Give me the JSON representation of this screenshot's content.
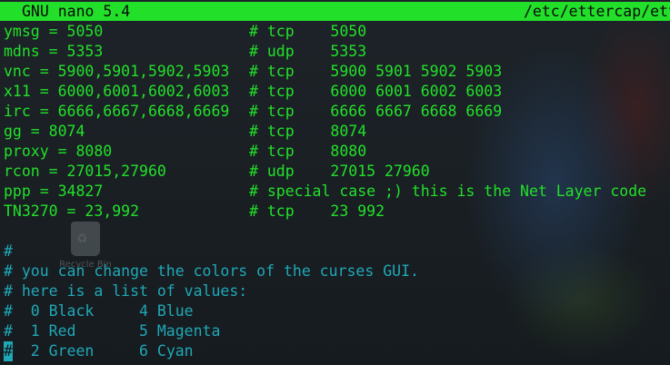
{
  "titlebar": {
    "app": "GNU nano 5.4",
    "path": "/etc/ettercap/ett"
  },
  "desktop": {
    "icon": "trash-icon",
    "caption": "Recycle Bin"
  },
  "config_lines": [
    {
      "setting": "ymsg = 5050",
      "comment": "# tcp    5050"
    },
    {
      "setting": "mdns = 5353",
      "comment": "# udp    5353"
    },
    {
      "setting": "vnc = 5900,5901,5902,5903",
      "comment": "# tcp    5900 5901 5902 5903"
    },
    {
      "setting": "x11 = 6000,6001,6002,6003",
      "comment": "# tcp    6000 6001 6002 6003"
    },
    {
      "setting": "irc = 6666,6667,6668,6669",
      "comment": "# tcp    6666 6667 6668 6669"
    },
    {
      "setting": "gg = 8074",
      "comment": "# tcp    8074"
    },
    {
      "setting": "proxy = 8080",
      "comment": "# tcp    8080"
    },
    {
      "setting": "rcon = 27015,27960",
      "comment": "# udp    27015 27960"
    },
    {
      "setting": "ppp = 34827",
      "comment": "# special case ;) this is the Net Layer code"
    },
    {
      "setting": "TN3270 = 23,992",
      "comment": "# tcp    23 992"
    }
  ],
  "comment_lines": [
    "",
    "#",
    "# you can change the colors of the curses GUI.",
    "# here is a list of values:",
    "#  0 Black     4 Blue",
    "#  1 Red       5 Magenta"
  ],
  "cursor_line": {
    "cursor_char": "#",
    "rest": "  2 Green     6 Cyan"
  },
  "colors": {
    "titlebar_bg": "#22e02a",
    "config_text": "#22e02a",
    "comment_text": "#1fa8b6",
    "background": "#1a1f23"
  }
}
